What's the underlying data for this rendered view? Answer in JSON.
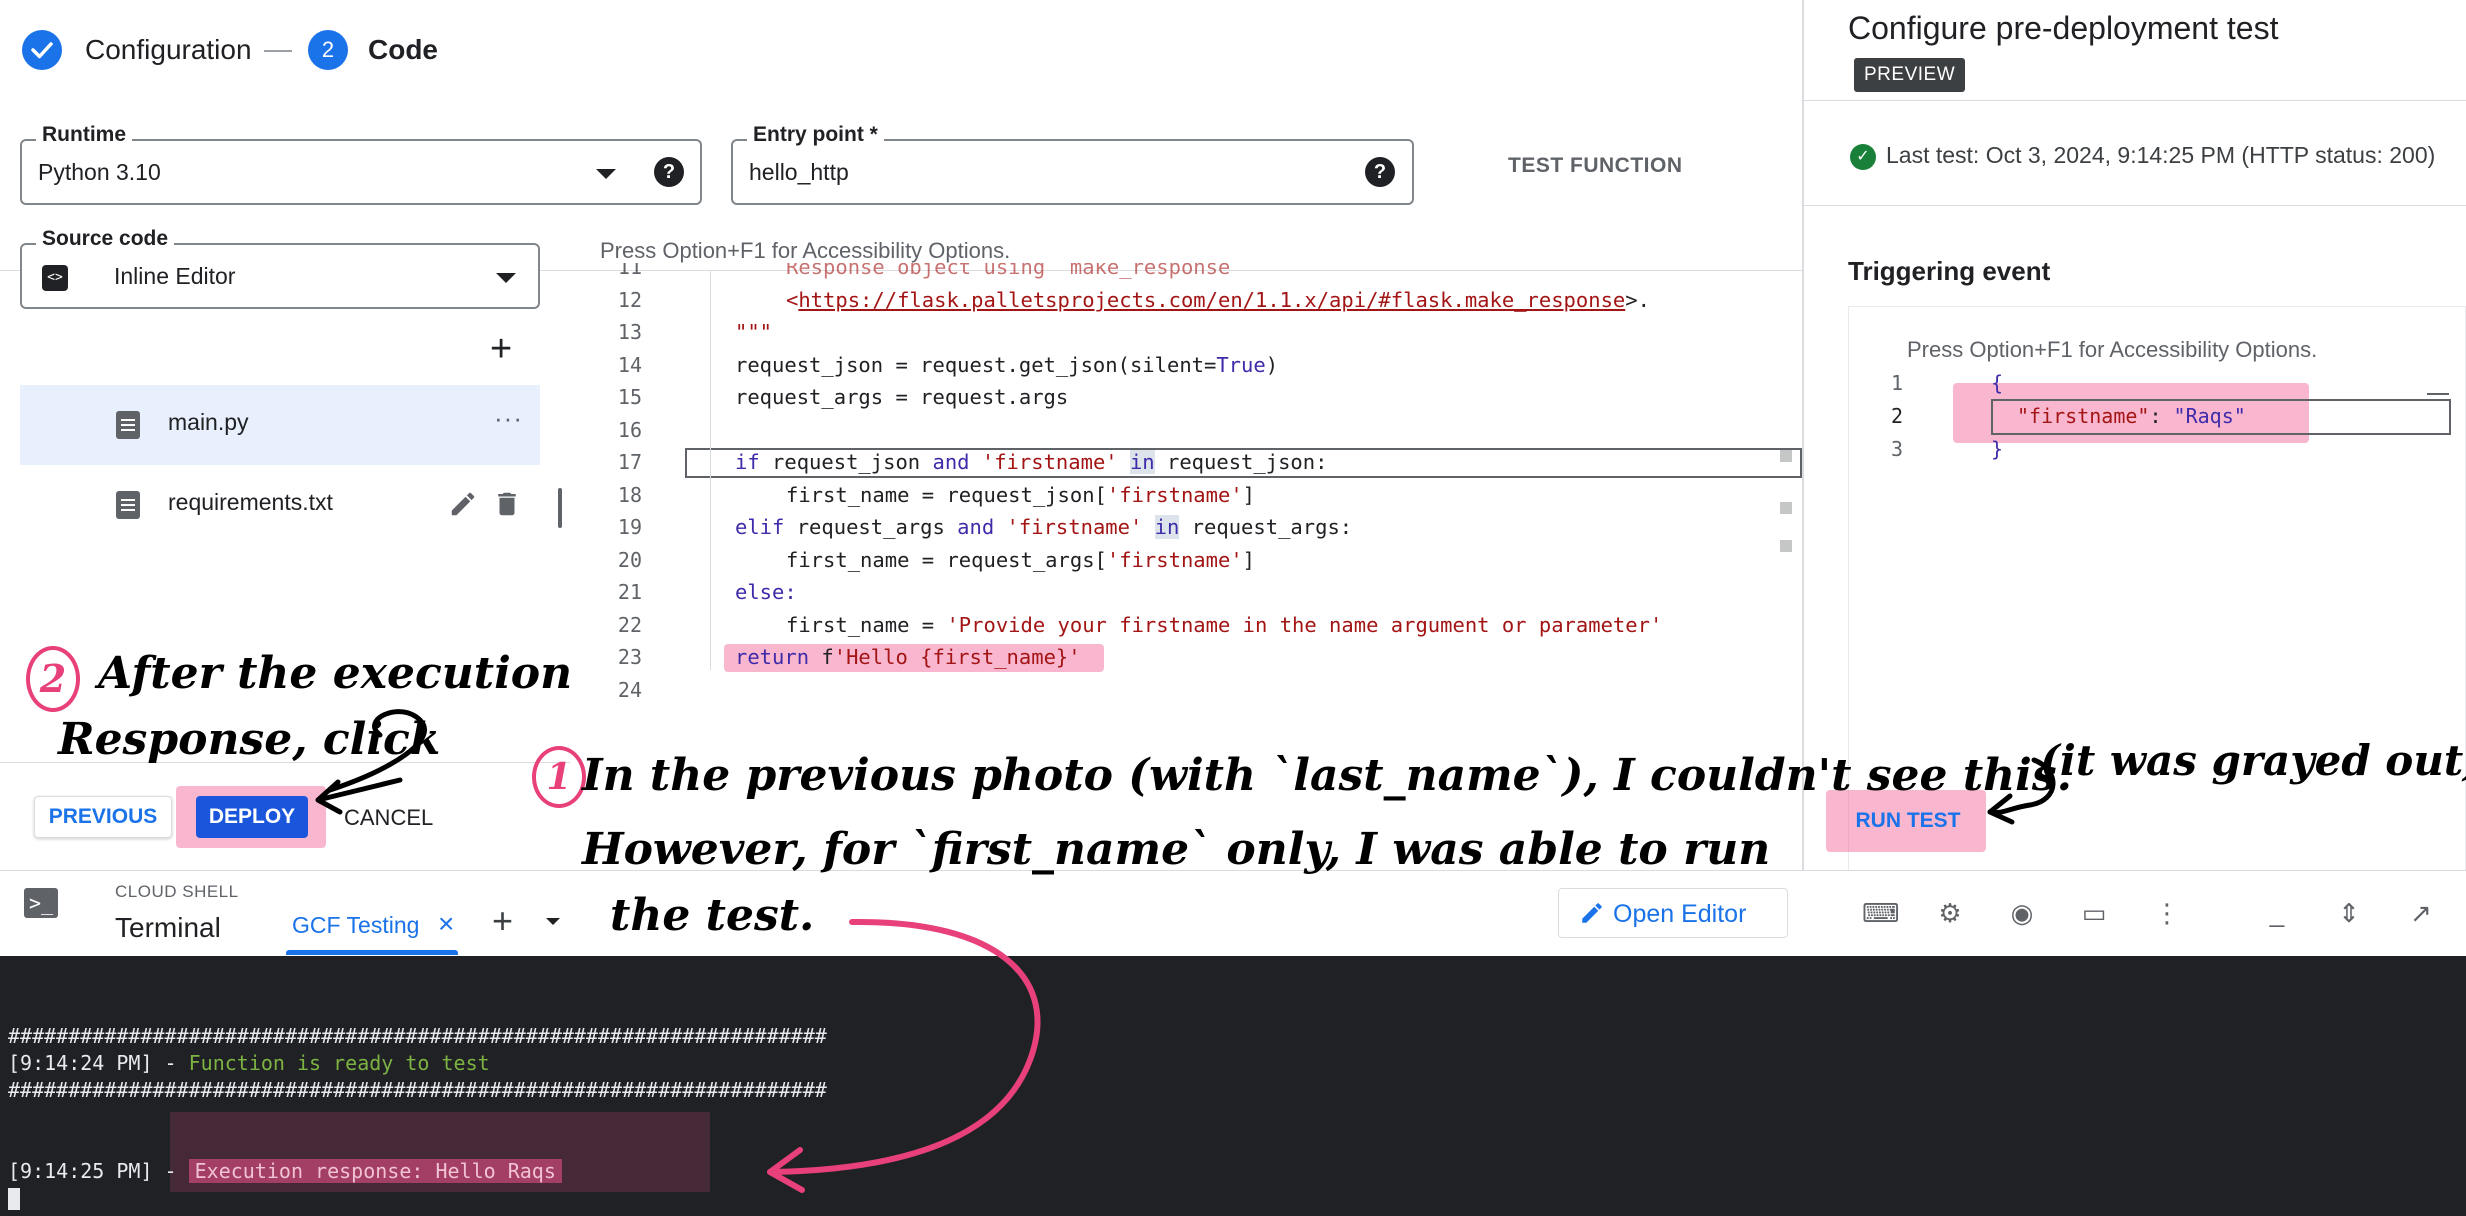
{
  "stepper": {
    "step1_label": "Configuration",
    "step2_number": "2",
    "step2_label": "Code"
  },
  "runtime": {
    "label": "Runtime",
    "value": "Python 3.10"
  },
  "entry_point": {
    "label": "Entry point *",
    "value": "hello_http"
  },
  "test_function_label": "TEST FUNCTION",
  "source_code": {
    "label": "Source code",
    "value": "Inline Editor"
  },
  "files": [
    {
      "name": "main.py"
    },
    {
      "name": "requirements.txt"
    }
  ],
  "editor": {
    "accessibility_hint": "Press Option+F1 for Accessibility Options.",
    "line_numbers": [
      "11",
      "12",
      "13",
      "14",
      "15",
      "16",
      "17",
      "18",
      "19",
      "20",
      "21",
      "22",
      "23",
      "24"
    ],
    "code": {
      "l11": "Response object using `make_response`",
      "l12_link": "https://flask.palletsprojects.com/en/1.1.x/api/#flask.make_response",
      "l12_lt": "<",
      "l12_gt": ">.",
      "l13": "\"\"\"",
      "l14a": "request_json = request.get_json(silent=",
      "l14b": "True",
      "l14c": ")",
      "l15": "request_args = request.args",
      "l17a": "if",
      "l17b": " request_json ",
      "l17c": "and",
      "l17d": " ",
      "l17e": "'firstname'",
      "l17f": " ",
      "l17g": "in",
      "l17h": " request_json:",
      "l18a": "first_name = request_json[",
      "l18b": "'firstname'",
      "l18c": "]",
      "l19a": "elif",
      "l19b": " request_args ",
      "l19c": "and",
      "l19d": " ",
      "l19e": "'firstname'",
      "l19f": " ",
      "l19g": "in",
      "l19h": " request_args:",
      "l20a": "first_name = request_args[",
      "l20b": "'firstname'",
      "l20c": "]",
      "l21": "else:",
      "l22a": "first_name = ",
      "l22b": "'Provide your firstname in the name argument or parameter'",
      "l23a": "return",
      "l23b": " f",
      "l23c": "'Hello {first_name}'"
    }
  },
  "buttons": {
    "previous": "PREVIOUS",
    "deploy": "DEPLOY",
    "cancel": "CANCEL",
    "run_test": "RUN TEST"
  },
  "right_panel": {
    "title": "Configure pre-deployment test",
    "badge": "PREVIEW",
    "last_test": "Last test: Oct 3, 2024, 9:14:25 PM (HTTP status: 200)",
    "triggering_event": "Triggering event",
    "accessibility_hint": "Press Option+F1 for Accessibility Options.",
    "json_line_numbers": [
      "1",
      "2",
      "3"
    ],
    "json_open": "{",
    "json_key": "\"firstname\"",
    "json_colon": ": ",
    "json_value": "\"Raqs\"",
    "json_close": "}"
  },
  "cloud_shell": {
    "caption": "CLOUD SHELL",
    "title": "Terminal",
    "tab": "GCF Testing",
    "tab_close": "×",
    "add_tab": "+",
    "open_editor": "Open Editor"
  },
  "terminal": {
    "hashes1": "####################################################################",
    "ready_time": "[9:14:24 PM] - ",
    "ready_msg": "Function is ready to test",
    "hashes2": "####################################################################",
    "resp_time": "[9:14:25 PM] - ",
    "resp_msg": "Execution response: Hello Raqs"
  },
  "annotations": {
    "note2_num": "2",
    "note2_line1": "After the execution",
    "note2_line2": "Response, click",
    "note1_num": "1",
    "note1_line1": "In the previous photo (with `last_name`), I couldn't see this.",
    "note1_aside": "(it was grayed out)",
    "note1_line2": "However, for `first_name` only, I was able to run",
    "note1_line3": "the test."
  },
  "colors": {
    "accent": "#1a73e8",
    "highlight": "#f0508c",
    "terminal_bg": "#202124",
    "terminal_green": "#7cb342",
    "ok_green": "#188038"
  }
}
